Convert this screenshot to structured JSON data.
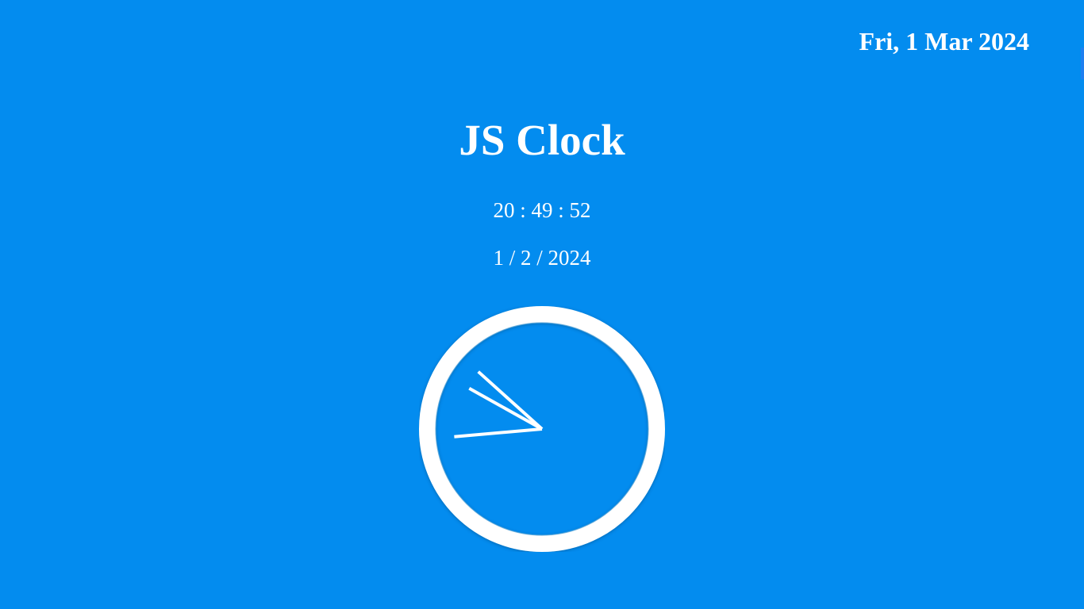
{
  "header": {
    "date_label": "Fri, 1 Mar 2024"
  },
  "main": {
    "title": "JS Clock",
    "digital_time": "20 : 49 : 52",
    "digital_date": "1 / 2 / 2024"
  },
  "clock": {
    "time": {
      "hours": 20,
      "minutes": 49,
      "seconds": 52
    },
    "colors": {
      "background": "#038cef",
      "ring": "#ffffff",
      "hands": "#ffffff"
    }
  }
}
